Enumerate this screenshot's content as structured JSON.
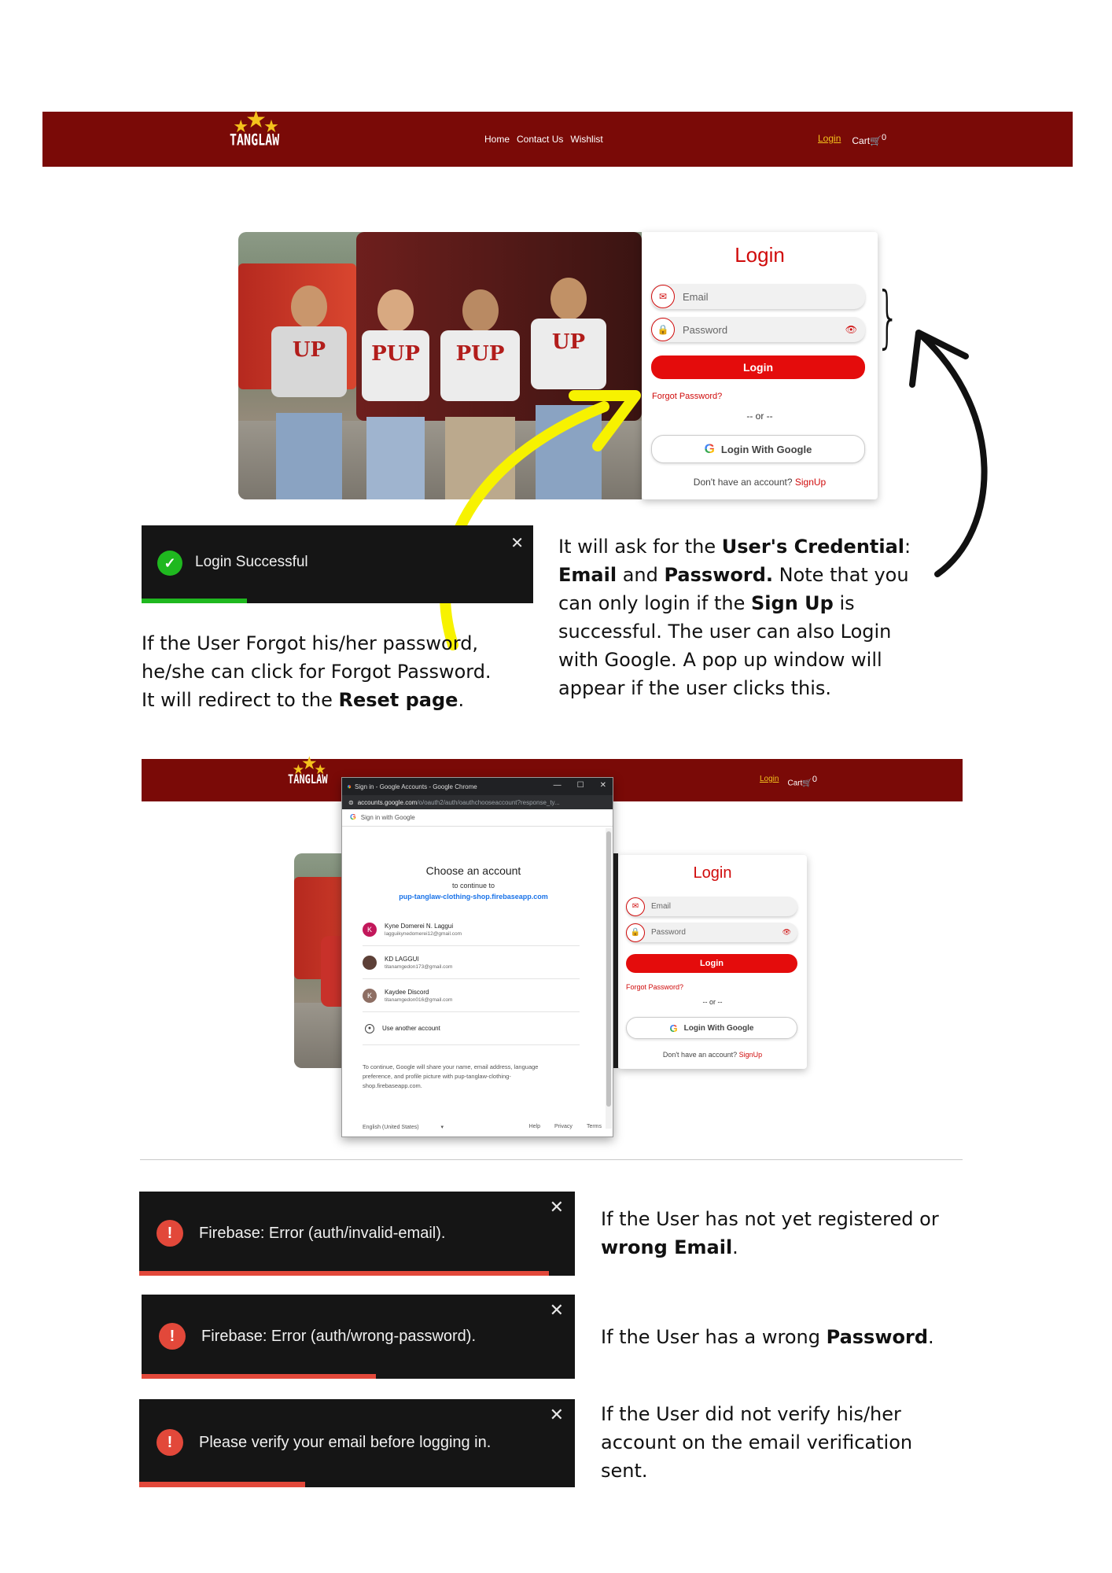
{
  "nav": {
    "logo_text": "TANGLAW",
    "links": [
      "Home",
      "Contact Us",
      "Wishlist"
    ],
    "login": "Login",
    "cart": "Cart",
    "cart_count": "0"
  },
  "login_card": {
    "title": "Login",
    "email_placeholder": "Email",
    "password_placeholder": "Password",
    "login_button": "Login",
    "forgot": "Forgot Password?",
    "or": "-- or --",
    "google_button": "Login With Google",
    "no_account": "Don't have an account?",
    "signup": "SignUp"
  },
  "toast_success": {
    "message": "Login Successful",
    "close": "✕"
  },
  "desc_credentials": {
    "p1": "It will ask for the ",
    "b1": "User's Credential",
    "p2": ": ",
    "b2": "Email",
    "p3": " and ",
    "b3": "Password.",
    "p4": " Note that you can only login if the ",
    "b4": "Sign Up",
    "p5": " is successful. The user can also Login with Google. A pop up window will appear if the user clicks this."
  },
  "desc_forgot": {
    "p1": "If the User Forgot his/her password, he/she can click for Forgot Password. It will redirect to the ",
    "b1": "Reset page",
    "p2": "."
  },
  "google_popup": {
    "window_title": "Sign in - Google Accounts - Google Chrome",
    "url_main": "accounts.google.com",
    "url_rest": "/o/oauth2/auth/oauthchooseaccount?response_ty...",
    "signin_with": "Sign in with Google",
    "heading": "Choose an account",
    "continue_to": "to continue to",
    "app_domain": "pup-tanglaw-clothing-shop.firebaseapp.com",
    "accounts": [
      {
        "name": "Kyne Domerei N. Laggui",
        "email": "lagguikynedomerei12@gmail.com",
        "initial": "K",
        "color": "#c2185b"
      },
      {
        "name": "KD LAGGUI",
        "email": "titanamgedon173@gmail.com",
        "initial": "",
        "color": "#5d4037"
      },
      {
        "name": "Kaydee Discord",
        "email": "titanamgedon016@gmail.com",
        "initial": "K",
        "color": "#8d6e63"
      }
    ],
    "another": "Use another account",
    "notice": "To continue, Google will share your name, email address, language preference, and profile picture with pup-tanglaw-clothing-shop.firebaseapp.com.",
    "lang": "English (United States)",
    "help": "Help",
    "privacy": "Privacy",
    "terms": "Terms"
  },
  "errors": [
    {
      "message": "Firebase: Error (auth/invalid-email).",
      "progress": 0.94
    },
    {
      "message": "Firebase: Error (auth/wrong-password).",
      "progress": 0.54
    },
    {
      "message": "Please verify your email before logging in.",
      "progress": 0.38
    }
  ],
  "toast_success_progress": 0.27,
  "desc_errors": {
    "e1_p1": "If the User has not yet registered or ",
    "e1_b": "wrong Email",
    "e1_p2": ".",
    "e2_p1": "If the User has a wrong ",
    "e2_b": "Password",
    "e2_p2": ".",
    "e3": "If the User did not verify his/her account on the email verification sent."
  },
  "colors": {
    "brand": "#7a0a07",
    "accent": "#d00b0b",
    "success": "#1fb81f",
    "error_bar": "#e2483a",
    "yellow_arrow": "#f7f200"
  }
}
